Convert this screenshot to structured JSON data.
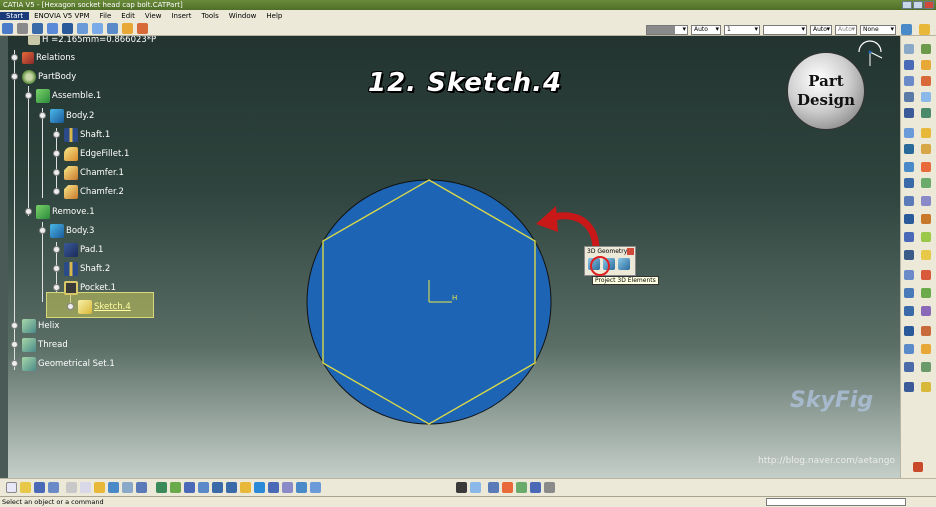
{
  "window": {
    "title": "CATIA V5 - [Hexagon socket head cap bolt.CATPart]"
  },
  "menubar": {
    "items": [
      "Start",
      "ENOVIA V5 VPM",
      "File",
      "Edit",
      "View",
      "Insert",
      "Tools",
      "Window",
      "Help"
    ]
  },
  "properties_bar": {
    "color_value": "",
    "transparency": "Auto",
    "line_type": "1",
    "line_thickness": "Auto",
    "point_type": "Auto",
    "layer": "None"
  },
  "viewport": {
    "heading": "12. Sketch.4",
    "badge_line1": "Part",
    "badge_line2": "Design",
    "origin_label": "H",
    "circle_color": "#1e64b4",
    "hexagon_color": "#d8d84a",
    "watermark_url": "http://blog.naver.com/aetango",
    "skylogo": "SkyFig"
  },
  "tree": {
    "top_partial": "H =2.165mm=0.866023*P",
    "items": [
      {
        "label": "Relations"
      },
      {
        "label": "PartBody"
      },
      {
        "label": "Assemble.1"
      },
      {
        "label": "Body.2"
      },
      {
        "label": "Shaft.1"
      },
      {
        "label": "EdgeFillet.1"
      },
      {
        "label": "Chamfer.1"
      },
      {
        "label": "Chamfer.2"
      },
      {
        "label": "Remove.1"
      },
      {
        "label": "Body.3"
      },
      {
        "label": "Pad.1"
      },
      {
        "label": "Shaft.2"
      },
      {
        "label": "Pocket.1"
      },
      {
        "label": "Sketch.4"
      },
      {
        "label": "Helix"
      },
      {
        "label": "Thread"
      },
      {
        "label": "Geometrical Set.1"
      }
    ]
  },
  "geometry_panel": {
    "title": "3D Geometry",
    "tooltip": "Project 3D Elements"
  },
  "statusbar": {
    "message": "Select an object or a command"
  }
}
